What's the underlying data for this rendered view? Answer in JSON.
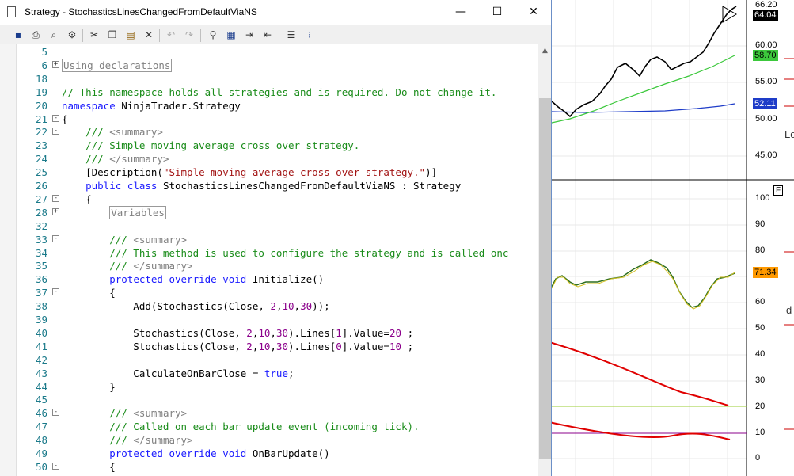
{
  "window": {
    "title": "Strategy - StochasticsLinesChangedFromDefaultViaNS",
    "minimize": "—",
    "maximize": "☐",
    "close": "✕"
  },
  "toolbar": {
    "icons": [
      "save-icon",
      "print-icon",
      "print-preview-icon",
      "page-setup-icon",
      "cut-icon",
      "copy-icon",
      "paste-icon",
      "delete-icon",
      "undo-icon",
      "redo-icon",
      "find-icon",
      "find-replace-icon",
      "indent-icon",
      "outdent-icon",
      "comment-icon",
      "uncomment-icon"
    ]
  },
  "code": {
    "lines": [
      {
        "n": "5",
        "fold": "",
        "segments": []
      },
      {
        "n": "6",
        "fold": "+",
        "segments": [
          {
            "t": "Using declarations",
            "c": "box"
          }
        ]
      },
      {
        "n": "18",
        "fold": "",
        "segments": []
      },
      {
        "n": "19",
        "fold": "",
        "segments": [
          {
            "t": "// This namespace holds all strategies and is required. Do not change it.",
            "c": "comment"
          }
        ]
      },
      {
        "n": "20",
        "fold": "",
        "segments": [
          {
            "t": "namespace",
            "c": "kw"
          },
          {
            "t": " NinjaTrader.Strategy",
            "c": "plain"
          }
        ]
      },
      {
        "n": "21",
        "fold": "-",
        "segments": [
          {
            "t": "{",
            "c": "plain"
          }
        ]
      },
      {
        "n": "22",
        "fold": "-",
        "segments": [
          {
            "t": "    /// ",
            "c": "comment"
          },
          {
            "t": "<summary>",
            "c": "doc"
          }
        ]
      },
      {
        "n": "23",
        "fold": "",
        "segments": [
          {
            "t": "    /// Simple moving average cross over strategy.",
            "c": "comment"
          }
        ]
      },
      {
        "n": "24",
        "fold": "",
        "segments": [
          {
            "t": "    /// ",
            "c": "comment"
          },
          {
            "t": "</summary>",
            "c": "doc"
          }
        ]
      },
      {
        "n": "25",
        "fold": "",
        "segments": [
          {
            "t": "    [Description(",
            "c": "plain"
          },
          {
            "t": "\"Simple moving average cross over strategy.\"",
            "c": "str"
          },
          {
            "t": ")]",
            "c": "plain"
          }
        ]
      },
      {
        "n": "26",
        "fold": "",
        "segments": [
          {
            "t": "    ",
            "c": "plain"
          },
          {
            "t": "public class",
            "c": "kw"
          },
          {
            "t": " StochasticsLinesChangedFromDefaultViaNS : Strategy",
            "c": "plain"
          }
        ]
      },
      {
        "n": "27",
        "fold": "-",
        "segments": [
          {
            "t": "    {",
            "c": "plain"
          }
        ]
      },
      {
        "n": "28",
        "fold": "+",
        "segments": [
          {
            "t": "        ",
            "c": "plain"
          },
          {
            "t": "Variables",
            "c": "box"
          }
        ]
      },
      {
        "n": "32",
        "fold": "",
        "segments": []
      },
      {
        "n": "33",
        "fold": "-",
        "segments": [
          {
            "t": "        /// ",
            "c": "comment"
          },
          {
            "t": "<summary>",
            "c": "doc"
          }
        ]
      },
      {
        "n": "34",
        "fold": "",
        "segments": [
          {
            "t": "        /// This method is used to configure the strategy and is called onc",
            "c": "comment"
          }
        ]
      },
      {
        "n": "35",
        "fold": "",
        "segments": [
          {
            "t": "        /// ",
            "c": "comment"
          },
          {
            "t": "</summary>",
            "c": "doc"
          }
        ]
      },
      {
        "n": "36",
        "fold": "",
        "segments": [
          {
            "t": "        ",
            "c": "plain"
          },
          {
            "t": "protected override void",
            "c": "kw"
          },
          {
            "t": " Initialize()",
            "c": "plain"
          }
        ]
      },
      {
        "n": "37",
        "fold": "-",
        "segments": [
          {
            "t": "        {",
            "c": "plain"
          }
        ]
      },
      {
        "n": "38",
        "fold": "",
        "segments": [
          {
            "t": "            Add(Stochastics(Close, ",
            "c": "plain"
          },
          {
            "t": "2",
            "c": "num"
          },
          {
            "t": ",",
            "c": "plain"
          },
          {
            "t": "10",
            "c": "num"
          },
          {
            "t": ",",
            "c": "plain"
          },
          {
            "t": "30",
            "c": "num"
          },
          {
            "t": "));",
            "c": "plain"
          }
        ]
      },
      {
        "n": "39",
        "fold": "",
        "segments": []
      },
      {
        "n": "40",
        "fold": "",
        "segments": [
          {
            "t": "            Stochastics(Close, ",
            "c": "plain"
          },
          {
            "t": "2",
            "c": "num"
          },
          {
            "t": ",",
            "c": "plain"
          },
          {
            "t": "10",
            "c": "num"
          },
          {
            "t": ",",
            "c": "plain"
          },
          {
            "t": "30",
            "c": "num"
          },
          {
            "t": ").Lines[",
            "c": "plain"
          },
          {
            "t": "1",
            "c": "num"
          },
          {
            "t": "].Value=",
            "c": "plain"
          },
          {
            "t": "20",
            "c": "num"
          },
          {
            "t": " ;",
            "c": "plain"
          }
        ]
      },
      {
        "n": "41",
        "fold": "",
        "segments": [
          {
            "t": "            Stochastics(Close, ",
            "c": "plain"
          },
          {
            "t": "2",
            "c": "num"
          },
          {
            "t": ",",
            "c": "plain"
          },
          {
            "t": "10",
            "c": "num"
          },
          {
            "t": ",",
            "c": "plain"
          },
          {
            "t": "30",
            "c": "num"
          },
          {
            "t": ").Lines[",
            "c": "plain"
          },
          {
            "t": "0",
            "c": "num"
          },
          {
            "t": "].Value=",
            "c": "plain"
          },
          {
            "t": "10",
            "c": "num"
          },
          {
            "t": " ;",
            "c": "plain"
          }
        ]
      },
      {
        "n": "42",
        "fold": "",
        "segments": []
      },
      {
        "n": "43",
        "fold": "",
        "segments": [
          {
            "t": "            CalculateOnBarClose = ",
            "c": "plain"
          },
          {
            "t": "true",
            "c": "kw"
          },
          {
            "t": ";",
            "c": "plain"
          }
        ]
      },
      {
        "n": "44",
        "fold": "",
        "segments": [
          {
            "t": "        }",
            "c": "plain"
          }
        ]
      },
      {
        "n": "45",
        "fold": "",
        "segments": []
      },
      {
        "n": "46",
        "fold": "-",
        "segments": [
          {
            "t": "        /// ",
            "c": "comment"
          },
          {
            "t": "<summary>",
            "c": "doc"
          }
        ]
      },
      {
        "n": "47",
        "fold": "",
        "segments": [
          {
            "t": "        /// Called on each bar update event (incoming tick).",
            "c": "comment"
          }
        ]
      },
      {
        "n": "48",
        "fold": "",
        "segments": [
          {
            "t": "        /// ",
            "c": "comment"
          },
          {
            "t": "</summary>",
            "c": "doc"
          }
        ]
      },
      {
        "n": "49",
        "fold": "",
        "segments": [
          {
            "t": "        ",
            "c": "plain"
          },
          {
            "t": "protected override void",
            "c": "kw"
          },
          {
            "t": " OnBarUpdate()",
            "c": "plain"
          }
        ]
      },
      {
        "n": "50",
        "fold": "-",
        "segments": [
          {
            "t": "        {",
            "c": "plain"
          }
        ]
      }
    ]
  },
  "chart": {
    "price_axis": [
      "60.00",
      "55.00",
      "50.00",
      "45.00"
    ],
    "price_top_label": "66.20",
    "last_price": {
      "text": "64.04",
      "bg": "#000000",
      "fg": "#ffffff"
    },
    "sma_fast": {
      "text": "58.70",
      "bg": "#3cc83c",
      "fg": "#000000"
    },
    "sma_slow": {
      "text": "52.11",
      "bg": "#1e3cc8",
      "fg": "#ffffff"
    },
    "stoch_axis": [
      "100",
      "90",
      "80",
      "70",
      "60",
      "50",
      "40",
      "30",
      "20",
      "10",
      "0"
    ],
    "stoch_value": {
      "text": "71.34",
      "bg": "#ff9900",
      "fg": "#000000"
    },
    "panel_badge": "F",
    "edge_text_1": "Lo",
    "edge_text_2": "d"
  }
}
